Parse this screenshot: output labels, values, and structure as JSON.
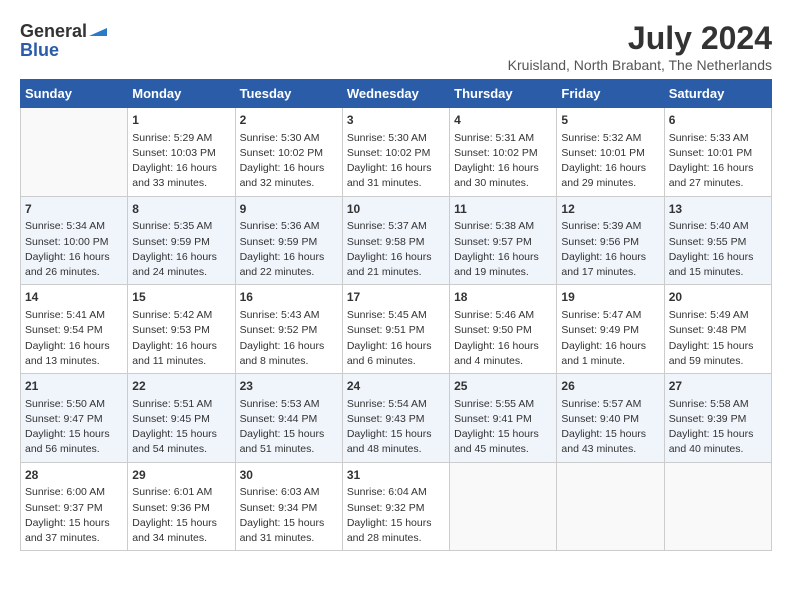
{
  "header": {
    "logo_general": "General",
    "logo_blue": "Blue",
    "month": "July 2024",
    "location": "Kruisland, North Brabant, The Netherlands"
  },
  "weekdays": [
    "Sunday",
    "Monday",
    "Tuesday",
    "Wednesday",
    "Thursday",
    "Friday",
    "Saturday"
  ],
  "weeks": [
    [
      {
        "day": "",
        "info": ""
      },
      {
        "day": "1",
        "info": "Sunrise: 5:29 AM\nSunset: 10:03 PM\nDaylight: 16 hours\nand 33 minutes."
      },
      {
        "day": "2",
        "info": "Sunrise: 5:30 AM\nSunset: 10:02 PM\nDaylight: 16 hours\nand 32 minutes."
      },
      {
        "day": "3",
        "info": "Sunrise: 5:30 AM\nSunset: 10:02 PM\nDaylight: 16 hours\nand 31 minutes."
      },
      {
        "day": "4",
        "info": "Sunrise: 5:31 AM\nSunset: 10:02 PM\nDaylight: 16 hours\nand 30 minutes."
      },
      {
        "day": "5",
        "info": "Sunrise: 5:32 AM\nSunset: 10:01 PM\nDaylight: 16 hours\nand 29 minutes."
      },
      {
        "day": "6",
        "info": "Sunrise: 5:33 AM\nSunset: 10:01 PM\nDaylight: 16 hours\nand 27 minutes."
      }
    ],
    [
      {
        "day": "7",
        "info": "Sunrise: 5:34 AM\nSunset: 10:00 PM\nDaylight: 16 hours\nand 26 minutes."
      },
      {
        "day": "8",
        "info": "Sunrise: 5:35 AM\nSunset: 9:59 PM\nDaylight: 16 hours\nand 24 minutes."
      },
      {
        "day": "9",
        "info": "Sunrise: 5:36 AM\nSunset: 9:59 PM\nDaylight: 16 hours\nand 22 minutes."
      },
      {
        "day": "10",
        "info": "Sunrise: 5:37 AM\nSunset: 9:58 PM\nDaylight: 16 hours\nand 21 minutes."
      },
      {
        "day": "11",
        "info": "Sunrise: 5:38 AM\nSunset: 9:57 PM\nDaylight: 16 hours\nand 19 minutes."
      },
      {
        "day": "12",
        "info": "Sunrise: 5:39 AM\nSunset: 9:56 PM\nDaylight: 16 hours\nand 17 minutes."
      },
      {
        "day": "13",
        "info": "Sunrise: 5:40 AM\nSunset: 9:55 PM\nDaylight: 16 hours\nand 15 minutes."
      }
    ],
    [
      {
        "day": "14",
        "info": "Sunrise: 5:41 AM\nSunset: 9:54 PM\nDaylight: 16 hours\nand 13 minutes."
      },
      {
        "day": "15",
        "info": "Sunrise: 5:42 AM\nSunset: 9:53 PM\nDaylight: 16 hours\nand 11 minutes."
      },
      {
        "day": "16",
        "info": "Sunrise: 5:43 AM\nSunset: 9:52 PM\nDaylight: 16 hours\nand 8 minutes."
      },
      {
        "day": "17",
        "info": "Sunrise: 5:45 AM\nSunset: 9:51 PM\nDaylight: 16 hours\nand 6 minutes."
      },
      {
        "day": "18",
        "info": "Sunrise: 5:46 AM\nSunset: 9:50 PM\nDaylight: 16 hours\nand 4 minutes."
      },
      {
        "day": "19",
        "info": "Sunrise: 5:47 AM\nSunset: 9:49 PM\nDaylight: 16 hours\nand 1 minute."
      },
      {
        "day": "20",
        "info": "Sunrise: 5:49 AM\nSunset: 9:48 PM\nDaylight: 15 hours\nand 59 minutes."
      }
    ],
    [
      {
        "day": "21",
        "info": "Sunrise: 5:50 AM\nSunset: 9:47 PM\nDaylight: 15 hours\nand 56 minutes."
      },
      {
        "day": "22",
        "info": "Sunrise: 5:51 AM\nSunset: 9:45 PM\nDaylight: 15 hours\nand 54 minutes."
      },
      {
        "day": "23",
        "info": "Sunrise: 5:53 AM\nSunset: 9:44 PM\nDaylight: 15 hours\nand 51 minutes."
      },
      {
        "day": "24",
        "info": "Sunrise: 5:54 AM\nSunset: 9:43 PM\nDaylight: 15 hours\nand 48 minutes."
      },
      {
        "day": "25",
        "info": "Sunrise: 5:55 AM\nSunset: 9:41 PM\nDaylight: 15 hours\nand 45 minutes."
      },
      {
        "day": "26",
        "info": "Sunrise: 5:57 AM\nSunset: 9:40 PM\nDaylight: 15 hours\nand 43 minutes."
      },
      {
        "day": "27",
        "info": "Sunrise: 5:58 AM\nSunset: 9:39 PM\nDaylight: 15 hours\nand 40 minutes."
      }
    ],
    [
      {
        "day": "28",
        "info": "Sunrise: 6:00 AM\nSunset: 9:37 PM\nDaylight: 15 hours\nand 37 minutes."
      },
      {
        "day": "29",
        "info": "Sunrise: 6:01 AM\nSunset: 9:36 PM\nDaylight: 15 hours\nand 34 minutes."
      },
      {
        "day": "30",
        "info": "Sunrise: 6:03 AM\nSunset: 9:34 PM\nDaylight: 15 hours\nand 31 minutes."
      },
      {
        "day": "31",
        "info": "Sunrise: 6:04 AM\nSunset: 9:32 PM\nDaylight: 15 hours\nand 28 minutes."
      },
      {
        "day": "",
        "info": ""
      },
      {
        "day": "",
        "info": ""
      },
      {
        "day": "",
        "info": ""
      }
    ]
  ]
}
